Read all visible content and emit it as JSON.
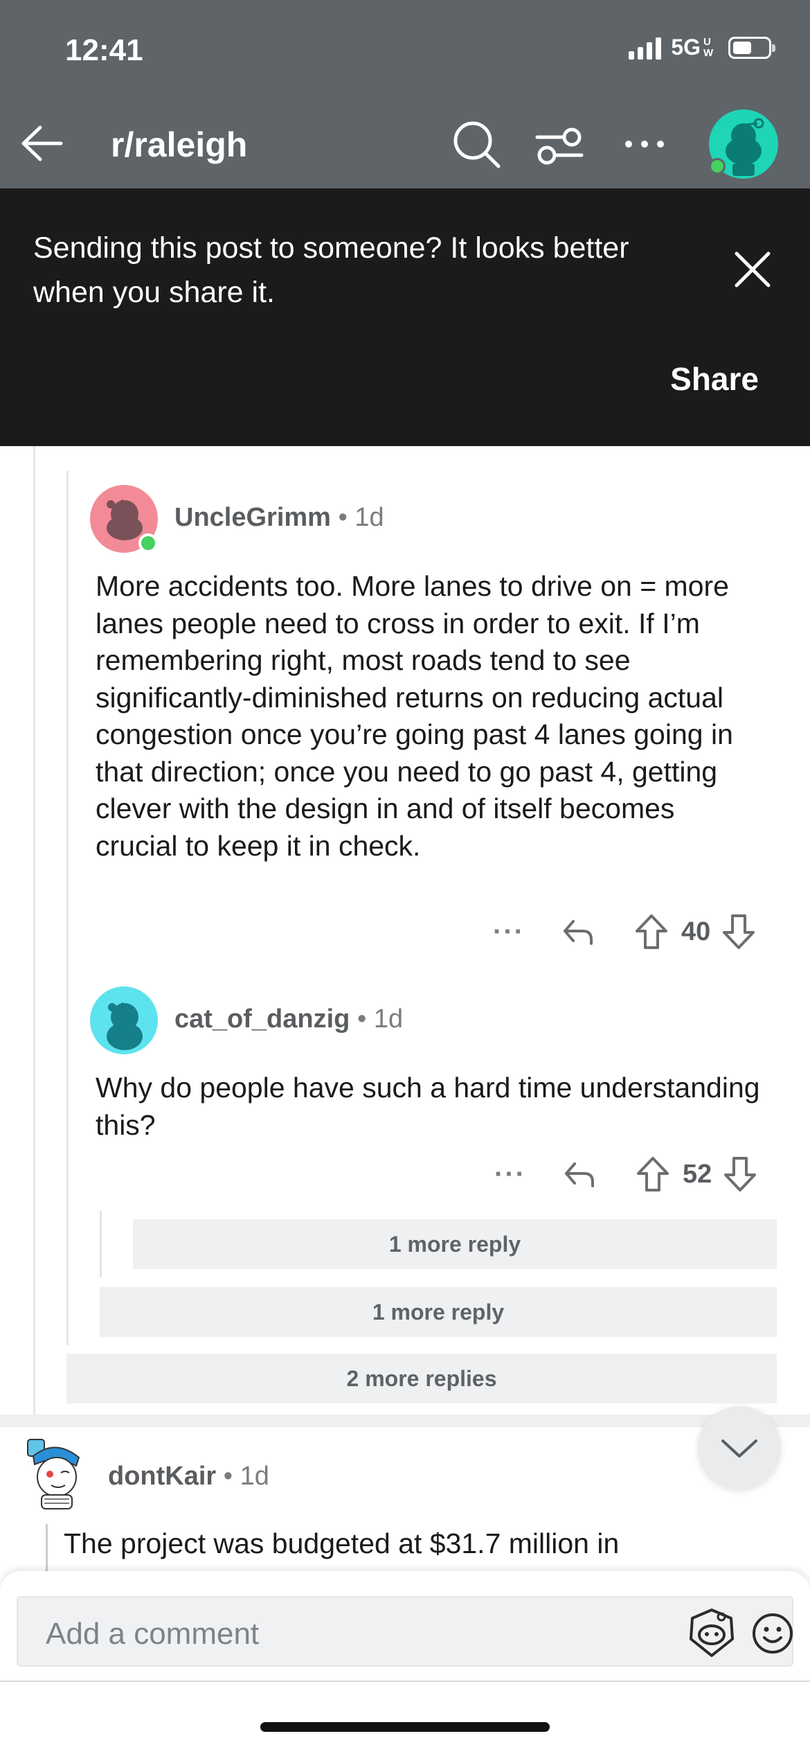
{
  "status": {
    "time": "12:41",
    "network": "5G",
    "network_suffix": "UW"
  },
  "header": {
    "subreddit": "r/raleigh"
  },
  "banner": {
    "message": "Sending this post to someone? It looks better when you share it.",
    "action": "Share"
  },
  "comments": [
    {
      "author": "UncleGrimm",
      "age": "1d",
      "body": "More accidents too. More lanes to drive on = more lanes people need to cross in order to exit. If I’m remembering right, most roads tend to see significantly-diminished returns on reducing actual congestion once you’re going past 4 lanes going in that direction; once you need to go past 4, getting clever with the design in and of itself becomes crucial to keep it in check.",
      "score": "40"
    },
    {
      "author": "cat_of_danzig",
      "age": "1d",
      "body": "Why do people have such a hard time understanding this?",
      "score": "52"
    },
    {
      "author": "dontKair",
      "age": "1d",
      "body": "The project was budgeted at $31.7 million in"
    }
  ],
  "more_replies": [
    "1 more reply",
    "1 more reply",
    "2 more replies"
  ],
  "separator": "•",
  "actions": {
    "more_dots": "···"
  },
  "composer": {
    "placeholder": "Add a comment"
  },
  "colors": {
    "header_bg": "#5f6469",
    "banner_bg": "#1b1b1c",
    "avatar_teal": "#1ed5b6",
    "online_green": "#46d160"
  },
  "icons": [
    "back-arrow-icon",
    "search-icon",
    "filter-icon",
    "more-icon",
    "close-icon",
    "reply-icon",
    "upvote-icon",
    "downvote-icon",
    "chevron-down-icon",
    "snoo-icon",
    "emoji-icon"
  ]
}
